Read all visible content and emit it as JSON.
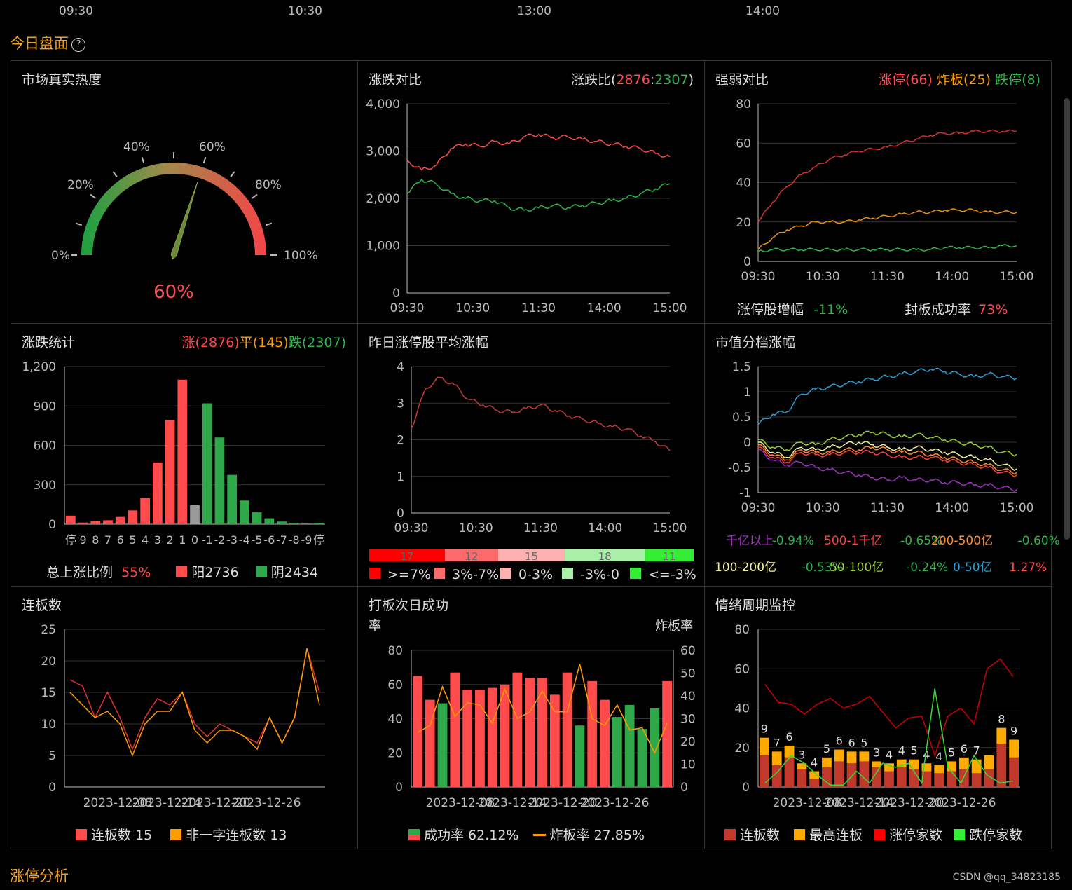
{
  "header": {
    "times": [
      "09:30",
      "10:30",
      "13:00",
      "14:00"
    ],
    "title": "今日盘面",
    "help_icon": "?"
  },
  "bottom_title": "涨停分析",
  "watermark": "CSDN @qq_34823185",
  "colors": {
    "up": "#ff4b4b",
    "down": "#2fb34a",
    "accent": "#f0a020"
  },
  "panels": {
    "heat": {
      "title": "市场真实热度",
      "value_text": "60%",
      "value": 0.6,
      "labels": [
        "0%",
        "20%",
        "40%",
        "60%",
        "80%",
        "100%"
      ]
    },
    "updown": {
      "title": "涨跌对比",
      "ratio_label": "涨跌比(",
      "up": "2876",
      "sep": ":",
      "down": "2307",
      "close": ")"
    },
    "strength": {
      "title": "强弱对比",
      "zt": "涨停(66)",
      "zb": "炸板(25)",
      "dt": "跌停(8)",
      "metric1_label": "涨停股增幅",
      "metric1_value": "-11%",
      "metric2_label": "封板成功率",
      "metric2_value": "73%"
    },
    "stats": {
      "title": "涨跌统计",
      "up": "涨(2876)",
      "flat": "平(145)",
      "down": "跌(2307)",
      "ratio_label": "总上涨比例",
      "ratio_value": "55%",
      "yang": "阳2736",
      "yin": "阴2434"
    },
    "yesterday": {
      "title": "昨日涨停股平均涨幅",
      "bands": [
        {
          "value": "17",
          "color": "#ff0000"
        },
        {
          "value": "12",
          "color": "#ff6b6b"
        },
        {
          "value": "15",
          "color": "#ffb0b0"
        },
        {
          "value": "18",
          "color": "#a8f0a8"
        },
        {
          "value": "11",
          "color": "#33ee33"
        }
      ],
      "legend": [
        {
          "label": ">=7%",
          "color": "#ff0000"
        },
        {
          "label": "3%-7%",
          "color": "#ff6b6b"
        },
        {
          "label": "0-3%",
          "color": "#ffb0b0"
        },
        {
          "label": "-3%-0",
          "color": "#a8f0a8"
        },
        {
          "label": "<=-3%",
          "color": "#33ee33"
        }
      ]
    },
    "mcap": {
      "title": "市值分档涨幅",
      "legend": [
        {
          "label": "千亿以上",
          "value": "-0.94%",
          "color": "#a030c0",
          "vcolor": "#2fb34a"
        },
        {
          "label": "500-1千亿",
          "value": "-0.65%",
          "color": "#ff4040",
          "vcolor": "#2fb34a"
        },
        {
          "label": "200-500亿",
          "value": "-0.60%",
          "color": "#ff8c30",
          "vcolor": "#2fb34a"
        },
        {
          "label": "100-200亿",
          "value": "-0.53%",
          "color": "#f0f0a0",
          "vcolor": "#2fb34a"
        },
        {
          "label": "50-100亿",
          "value": "-0.24%",
          "color": "#9acd32",
          "vcolor": "#2fb34a"
        },
        {
          "label": "0-50亿",
          "value": "1.27%",
          "color": "#2a9fd8",
          "vcolor": "#ff4b4b"
        }
      ]
    },
    "lianban": {
      "title": "连板数",
      "legend1": "连板数 15",
      "legend2": "非一字连板数 13"
    },
    "daban": {
      "title": "打板次日成功",
      "left_axis": "率",
      "right_axis": "炸板率",
      "legend1": "成功率 62.12%",
      "legend2": "炸板率 27.85%"
    },
    "cycle": {
      "title": "情绪周期监控",
      "legend": [
        "连板数",
        "最高连板",
        "涨停家数",
        "跌停家数"
      ]
    }
  },
  "chart_data": [
    {
      "type": "line",
      "title": "涨跌对比",
      "x_ticks": [
        "09:30",
        "10:30",
        "11:30",
        "14:00",
        "15:00"
      ],
      "ylim": [
        0,
        4000
      ],
      "y_ticks": [
        "0",
        "1,000",
        "2,000",
        "3,000",
        "4,000"
      ],
      "series": [
        {
          "name": "涨",
          "color": "#ff4b4b",
          "values": [
            2800,
            2600,
            2700,
            3050,
            3150,
            3100,
            3200,
            3150,
            3300,
            3350,
            3280,
            3300,
            3250,
            3200,
            3150,
            3100,
            3050,
            2950,
            2880
          ]
        },
        {
          "name": "跌",
          "color": "#2fb34a",
          "values": [
            2100,
            2400,
            2300,
            2100,
            2000,
            1950,
            1950,
            1800,
            1750,
            1800,
            1850,
            1800,
            1850,
            1900,
            1950,
            2000,
            2100,
            2200,
            2307
          ]
        }
      ]
    },
    {
      "type": "line",
      "title": "强弱对比",
      "x_ticks": [
        "09:30",
        "10:30",
        "11:30",
        "14:00",
        "15:00"
      ],
      "ylim": [
        0,
        80
      ],
      "y_ticks": [
        "0",
        "20",
        "40",
        "60",
        "80"
      ],
      "series": [
        {
          "name": "涨停",
          "color": "#d83030",
          "values": [
            20,
            30,
            38,
            44,
            48,
            52,
            54,
            56,
            57,
            58,
            60,
            62,
            64,
            65,
            65,
            66,
            66,
            66,
            66
          ]
        },
        {
          "name": "炸板",
          "color": "#e8900a",
          "values": [
            6,
            12,
            16,
            18,
            20,
            20,
            20,
            21,
            22,
            23,
            24,
            25,
            25,
            26,
            26,
            26,
            25,
            25,
            25
          ]
        },
        {
          "name": "跌停",
          "color": "#2fb34a",
          "values": [
            5,
            6,
            6,
            6,
            6,
            6,
            6,
            6,
            6,
            6,
            6,
            6,
            6,
            7,
            7,
            7,
            7,
            8,
            8
          ]
        }
      ]
    },
    {
      "type": "bar",
      "title": "涨跌统计",
      "categories": [
        "停",
        "9",
        "8",
        "7",
        "6",
        "5",
        "4",
        "3",
        "2",
        "1",
        "0",
        "-1",
        "-2",
        "-3",
        "-4",
        "-5",
        "-6",
        "-7",
        "-8",
        "-9",
        "停"
      ],
      "values": [
        65,
        12,
        22,
        30,
        55,
        105,
        200,
        470,
        795,
        1100,
        145,
        920,
        660,
        375,
        180,
        90,
        45,
        20,
        10,
        5,
        10
      ],
      "colors": [
        "#ff4b4b",
        "#ff4b4b",
        "#ff4b4b",
        "#ff4b4b",
        "#ff4b4b",
        "#ff4b4b",
        "#ff4b4b",
        "#ff4b4b",
        "#ff4b4b",
        "#ff4b4b",
        "#999999",
        "#2fa84a",
        "#2fa84a",
        "#2fa84a",
        "#2fa84a",
        "#2fa84a",
        "#2fa84a",
        "#2fa84a",
        "#2fa84a",
        "#2fa84a",
        "#2fa84a"
      ],
      "ylim": [
        0,
        1200
      ],
      "y_ticks": [
        "0",
        "300",
        "600",
        "900",
        "1,200"
      ]
    },
    {
      "type": "line",
      "title": "昨日涨停股平均涨幅",
      "x_ticks": [
        "09:30",
        "10:30",
        "11:30",
        "14:00",
        "15:00"
      ],
      "ylim": [
        0,
        4
      ],
      "y_ticks": [
        "0",
        "1",
        "2",
        "3",
        "4"
      ],
      "series": [
        {
          "name": "平均涨幅",
          "color": "#c03a3a",
          "values": [
            2.3,
            3.4,
            3.7,
            3.5,
            3.1,
            2.95,
            2.8,
            2.75,
            2.85,
            2.95,
            2.8,
            2.65,
            2.55,
            2.45,
            2.35,
            2.3,
            2.1,
            1.95,
            1.7
          ]
        }
      ]
    },
    {
      "type": "line",
      "title": "市值分档涨幅",
      "x_ticks": [
        "09:30",
        "10:30",
        "11:30",
        "14:00",
        "15:00"
      ],
      "ylim": [
        -1,
        1.5
      ],
      "y_ticks": [
        "-1",
        "-0.5",
        "0",
        "0.5",
        "1",
        "1.5"
      ],
      "series": [
        {
          "name": "0-50亿",
          "color": "#2a9fd8",
          "values": [
            0.35,
            0.55,
            0.6,
            0.95,
            1.05,
            1.1,
            1.15,
            1.2,
            1.25,
            1.3,
            1.35,
            1.4,
            1.45,
            1.4,
            1.35,
            1.3,
            1.35,
            1.3,
            1.27
          ]
        },
        {
          "name": "50-100亿",
          "color": "#9acd32",
          "values": [
            0.05,
            -0.1,
            -0.15,
            0.0,
            -0.05,
            0.05,
            0.1,
            0.15,
            0.2,
            0.15,
            0.1,
            0.15,
            0.1,
            0.05,
            0.0,
            -0.05,
            -0.1,
            -0.2,
            -0.24
          ]
        },
        {
          "name": "100-200亿",
          "color": "#f0f0a0",
          "values": [
            0.0,
            -0.2,
            -0.3,
            -0.1,
            -0.15,
            -0.1,
            -0.05,
            0.0,
            -0.05,
            -0.1,
            -0.15,
            -0.1,
            -0.15,
            -0.2,
            -0.25,
            -0.3,
            -0.35,
            -0.45,
            -0.53
          ]
        },
        {
          "name": "200-500亿",
          "color": "#ff8c30",
          "values": [
            -0.05,
            -0.25,
            -0.35,
            -0.15,
            -0.2,
            -0.2,
            -0.15,
            -0.15,
            -0.1,
            -0.15,
            -0.2,
            -0.2,
            -0.25,
            -0.3,
            -0.35,
            -0.4,
            -0.45,
            -0.55,
            -0.6
          ]
        },
        {
          "name": "500-1千亿",
          "color": "#ff4040",
          "values": [
            -0.1,
            -0.3,
            -0.4,
            -0.2,
            -0.25,
            -0.25,
            -0.2,
            -0.2,
            -0.2,
            -0.25,
            -0.3,
            -0.3,
            -0.3,
            -0.35,
            -0.4,
            -0.45,
            -0.5,
            -0.6,
            -0.65
          ]
        },
        {
          "name": "千亿以上",
          "color": "#a030c0",
          "values": [
            -0.15,
            -0.35,
            -0.45,
            -0.4,
            -0.5,
            -0.55,
            -0.6,
            -0.65,
            -0.7,
            -0.75,
            -0.7,
            -0.75,
            -0.75,
            -0.8,
            -0.8,
            -0.85,
            -0.85,
            -0.9,
            -0.94
          ]
        }
      ]
    },
    {
      "type": "line",
      "title": "连板数",
      "x_ticks": [
        "2023-12-08",
        "2023-12-14",
        "2023-12-20",
        "2023-12-26"
      ],
      "ylim": [
        0,
        25
      ],
      "y_ticks": [
        "0",
        "5",
        "10",
        "15",
        "20",
        "25"
      ],
      "series": [
        {
          "name": "连板数",
          "color": "#e03030",
          "values": [
            17,
            16,
            11,
            15,
            11,
            6,
            11,
            14,
            13,
            15,
            10,
            8,
            10,
            9,
            8,
            7,
            11,
            7,
            11,
            22,
            15
          ]
        },
        {
          "name": "非一字连板数",
          "color": "#ff9c00",
          "values": [
            15,
            13,
            11,
            12,
            10,
            5,
            10,
            12,
            12,
            15,
            9,
            7,
            9,
            9,
            8,
            6,
            11,
            7,
            11,
            22,
            13
          ]
        }
      ]
    },
    {
      "type": "bar",
      "title": "打板次日成功",
      "x_ticks": [
        "2023-12-08",
        "2023-12-14",
        "2023-12-20",
        "2023-12-26"
      ],
      "ylim": [
        0,
        80
      ],
      "y2lim": [
        0,
        60
      ],
      "values": [
        65,
        51,
        49,
        67,
        57,
        57,
        58,
        60,
        67,
        64,
        64,
        54,
        67,
        36,
        62,
        51,
        41,
        48,
        34,
        46,
        62
      ],
      "colors": [
        "#ff4b4b",
        "#ff4b4b",
        "#2fa84a",
        "#ff4b4b",
        "#ff4b4b",
        "#ff4b4b",
        "#ff4b4b",
        "#ff4b4b",
        "#ff4b4b",
        "#ff4b4b",
        "#ff4b4b",
        "#ff4b4b",
        "#ff4b4b",
        "#2fa84a",
        "#ff4b4b",
        "#ff4b4b",
        "#2fa84a",
        "#2fa84a",
        "#2fa84a",
        "#2fa84a",
        "#ff4b4b"
      ],
      "line": {
        "name": "炸板率",
        "color": "#ff9c00",
        "values": [
          24,
          27,
          44,
          31,
          37,
          36,
          28,
          43,
          30,
          33,
          42,
          33,
          33,
          54,
          30,
          27,
          36,
          25,
          26,
          15,
          28
        ]
      }
    },
    {
      "type": "bar",
      "title": "情绪周期监控",
      "x_ticks": [
        "2023-12-08",
        "2023-12-14",
        "2023-12-20",
        "2023-12-26"
      ],
      "ylim": [
        0,
        80
      ],
      "lianban": [
        16,
        11,
        15,
        9,
        4,
        10,
        13,
        12,
        13,
        10,
        8,
        10,
        9,
        8,
        7,
        8,
        9,
        7,
        9,
        22,
        15
      ],
      "zuigao": [
        9,
        7,
        6,
        3,
        4,
        5,
        6,
        6,
        5,
        3,
        4,
        4,
        5,
        4,
        4,
        5,
        6,
        7,
        7,
        8,
        9
      ],
      "zuigao_labels": [
        "9",
        "7",
        "6",
        "3",
        "4",
        "5",
        "6",
        "6",
        "5",
        "3",
        "4",
        "4",
        "5",
        "4",
        "4",
        "5",
        "6",
        "7",
        "",
        "8",
        "9"
      ],
      "series": [
        {
          "name": "涨停家数",
          "color": "#cc0000",
          "values": [
            52,
            43,
            42,
            37,
            42,
            45,
            40,
            42,
            46,
            38,
            30,
            35,
            36,
            16,
            36,
            40,
            32,
            60,
            65,
            56
          ]
        },
        {
          "name": "跌停家数",
          "color": "#33dd33",
          "values": [
            2,
            8,
            16,
            12,
            6,
            1,
            1,
            8,
            2,
            12,
            10,
            12,
            2,
            50,
            10,
            2,
            16,
            6,
            2,
            3
          ]
        }
      ]
    }
  ]
}
